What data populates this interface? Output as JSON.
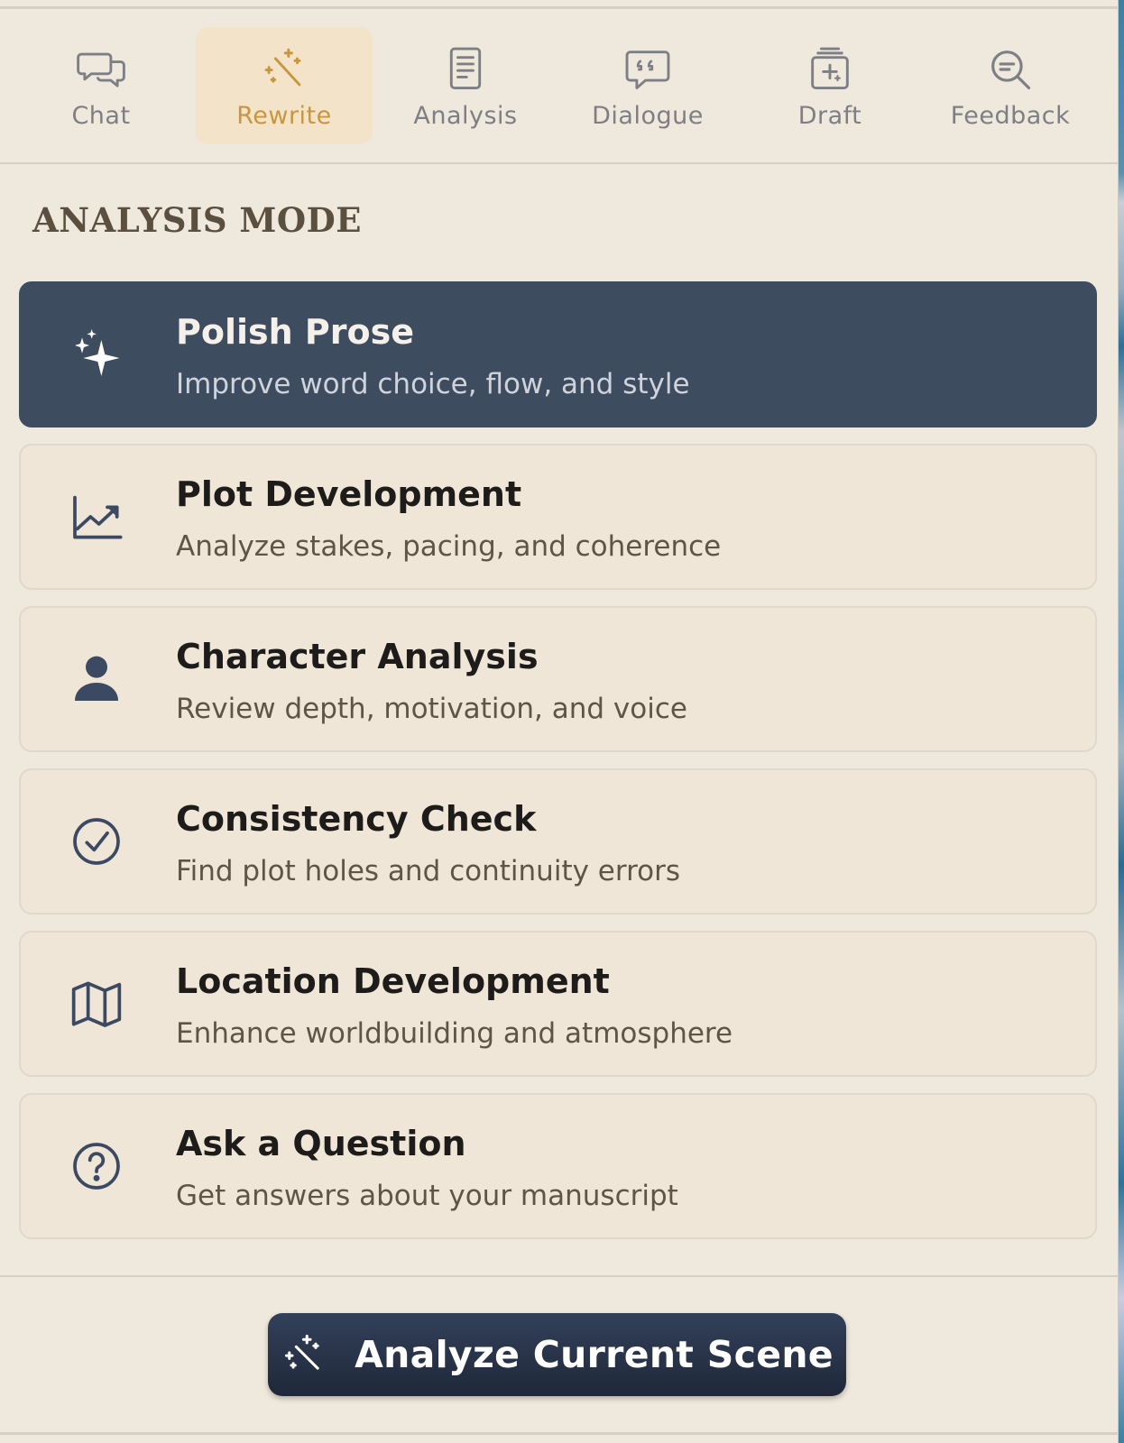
{
  "tabs": [
    {
      "label": "Chat",
      "icon": "chat-bubbles-icon"
    },
    {
      "label": "Rewrite",
      "icon": "magic-wand-icon",
      "active": true
    },
    {
      "label": "Analysis",
      "icon": "document-icon"
    },
    {
      "label": "Dialogue",
      "icon": "quote-bubble-icon"
    },
    {
      "label": "Draft",
      "icon": "draft-stack-icon"
    },
    {
      "label": "Feedback",
      "icon": "magnifier-icon"
    }
  ],
  "section_title": "ANALYSIS MODE",
  "modes": [
    {
      "title": "Polish Prose",
      "description": "Improve word choice, flow, and style",
      "icon": "sparkles-icon",
      "selected": true
    },
    {
      "title": "Plot Development",
      "description": "Analyze stakes, pacing, and coherence",
      "icon": "trend-chart-icon"
    },
    {
      "title": "Character Analysis",
      "description": "Review depth, motivation, and voice",
      "icon": "person-icon"
    },
    {
      "title": "Consistency Check",
      "description": "Find plot holes and continuity errors",
      "icon": "check-circle-icon"
    },
    {
      "title": "Location Development",
      "description": "Enhance worldbuilding and atmosphere",
      "icon": "map-icon"
    },
    {
      "title": "Ask a Question",
      "description": "Get answers about your manuscript",
      "icon": "question-circle-icon"
    }
  ],
  "action_button": {
    "label": "Analyze Current Scene",
    "icon": "magic-wand-icon"
  },
  "colors": {
    "panel_bg": "#efe8dc",
    "active_tab_bg": "#f2e3c9",
    "active_tab_text": "#c99640",
    "selected_card_bg": "#3e4c60",
    "icon_navy": "#3b4a62",
    "button_bg": "#26304a"
  }
}
